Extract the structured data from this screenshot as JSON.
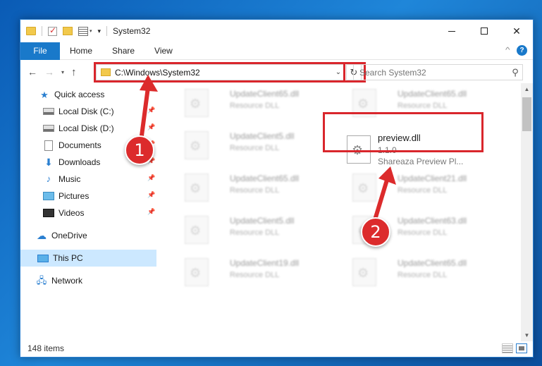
{
  "window": {
    "title": "System32",
    "controls": {
      "minimize": "",
      "maximize": "",
      "close": "✕"
    }
  },
  "quick_access_toolbar": {
    "customize": "▾"
  },
  "ribbon": {
    "tabs": [
      "File",
      "Home",
      "Share",
      "View"
    ],
    "expand_icon": "^",
    "help_icon": "?"
  },
  "navigation": {
    "back": "←",
    "forward": "→",
    "recent": "▾",
    "up": "↑",
    "address": "C:\\Windows\\System32",
    "address_dropdown": "⌄",
    "refresh": "↻",
    "search_placeholder": "Search System32",
    "search_icon": "⚲"
  },
  "sidebar": {
    "items": [
      {
        "label": "Quick access",
        "icon": "star-icon",
        "pinned": false
      },
      {
        "label": "Local Disk (C:)",
        "icon": "drive-icon",
        "pinned": true
      },
      {
        "label": "Local Disk (D:)",
        "icon": "drive-icon",
        "pinned": true
      },
      {
        "label": "Documents",
        "icon": "documents-icon",
        "pinned": true
      },
      {
        "label": "Downloads",
        "icon": "downloads-icon",
        "pinned": true
      },
      {
        "label": "Music",
        "icon": "music-icon",
        "pinned": true
      },
      {
        "label": "Pictures",
        "icon": "pictures-icon",
        "pinned": true
      },
      {
        "label": "Videos",
        "icon": "videos-icon",
        "pinned": true
      },
      {
        "label": "OneDrive",
        "icon": "onedrive-icon",
        "pinned": false
      },
      {
        "label": "This PC",
        "icon": "this-pc-icon",
        "pinned": false,
        "selected": true
      },
      {
        "label": "Network",
        "icon": "network-icon",
        "pinned": false
      }
    ],
    "pin_glyph": "📌"
  },
  "files": [
    {
      "name": "UpdateClient65.dll",
      "type": "Resource DLL"
    },
    {
      "name": "UpdateClient65.dll",
      "type": "Resource DLL"
    },
    {
      "name": "UpdateClient5.dll",
      "type": "Resource DLL"
    },
    {
      "name": "preview.dll",
      "version": "1.1.0",
      "description": "Shareaza Preview Pl..."
    },
    {
      "name": "UpdateClient65.dll",
      "type": "Resource DLL"
    },
    {
      "name": "UpdateClient21.dll",
      "type": "Resource DLL"
    },
    {
      "name": "UpdateClient5.dll",
      "type": "Resource DLL"
    },
    {
      "name": "UpdateClient63.dll",
      "type": "Resource DLL"
    },
    {
      "name": "UpdateClient19.dll",
      "type": "Resource DLL"
    },
    {
      "name": "UpdateClient65.dll",
      "type": "Resource DLL"
    }
  ],
  "scrollbar": {
    "up": "▲",
    "down": "▼"
  },
  "status": {
    "item_count": "148 items"
  },
  "annotations": {
    "step1": "1",
    "step2": "2",
    "color": "#dc2b2c"
  }
}
